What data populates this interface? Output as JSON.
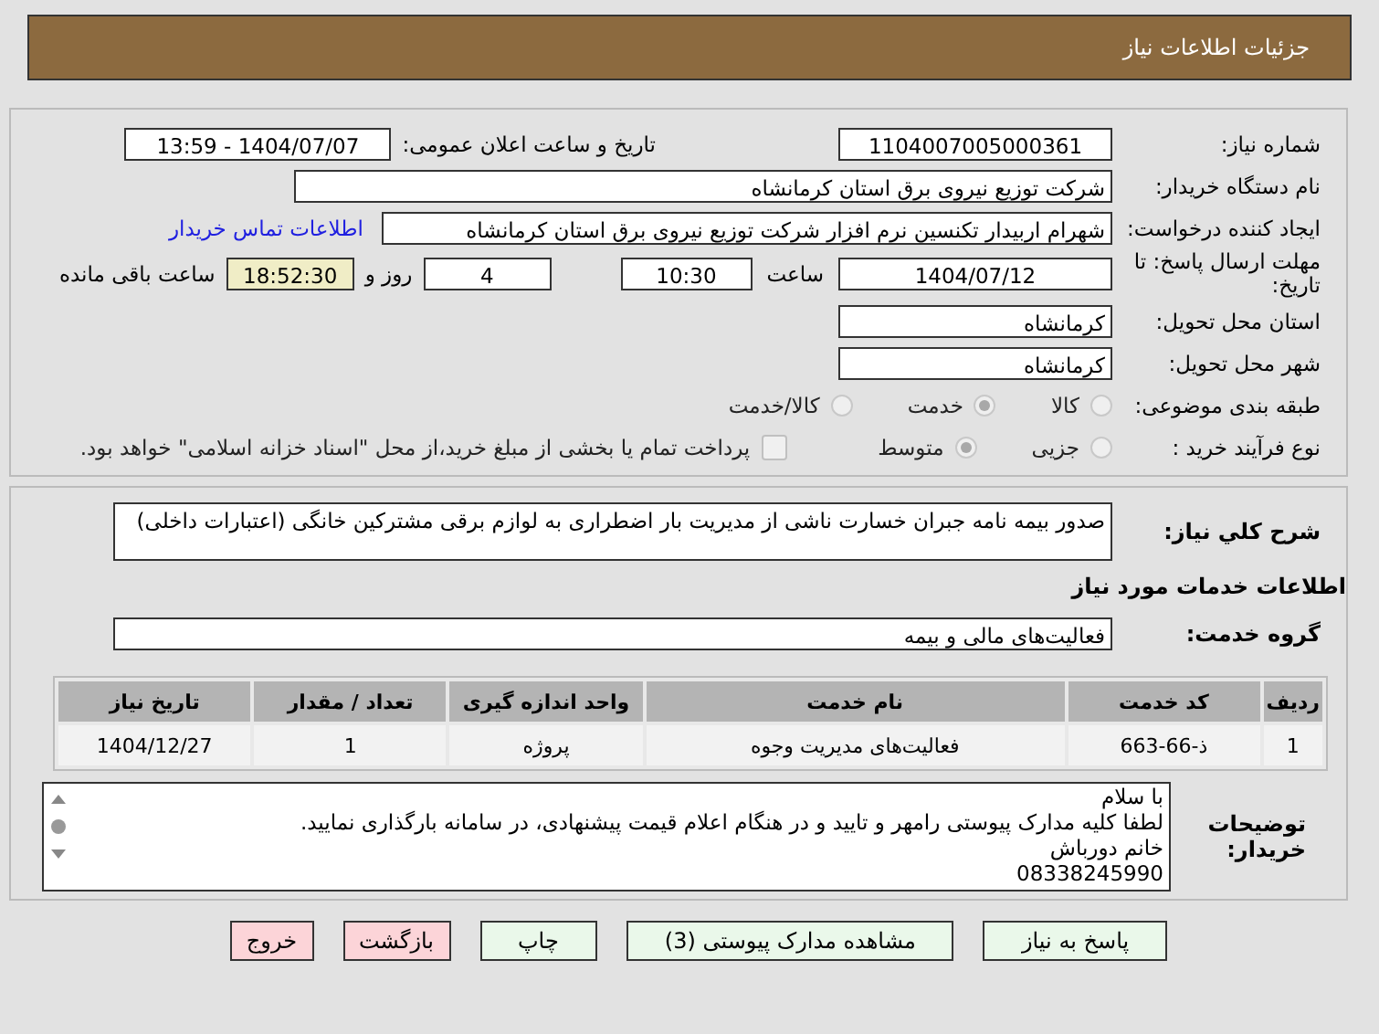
{
  "header": {
    "title": "جزئیات اطلاعات نیاز"
  },
  "details": {
    "need_number": {
      "label": "شماره نیاز:",
      "value": "1104007005000361"
    },
    "announce": {
      "label": "تاریخ و ساعت اعلان عمومی:",
      "value": "1404/07/07 - 13:59"
    },
    "buyer": {
      "label": "نام دستگاه خریدار:",
      "value": "شرکت توزیع نیروی برق استان کرمانشاه"
    },
    "creator": {
      "label": "ایجاد کننده درخواست:",
      "value": "شهرام اربیدار تکنسین نرم افزار شرکت توزیع نیروی برق استان کرمانشاه",
      "link": "اطلاعات تماس خریدار"
    },
    "deadline": {
      "label": "مهلت ارسال پاسخ: تا تاریخ:",
      "date": "1404/07/12",
      "time_label": "ساعت",
      "time": "10:30",
      "days": "4",
      "days_label": "روز و",
      "remaining": "18:52:30",
      "remaining_label": "ساعت باقی مانده"
    },
    "province": {
      "label": "استان محل تحویل:",
      "value": "کرمانشاه"
    },
    "city": {
      "label": "شهر محل تحویل:",
      "value": "کرمانشاه"
    },
    "category": {
      "label": "طبقه بندی موضوعی:",
      "options": [
        {
          "label": "کالا",
          "selected": false
        },
        {
          "label": "خدمت",
          "selected": true
        },
        {
          "label": "کالا/خدمت",
          "selected": false
        }
      ]
    },
    "process": {
      "label": "نوع فرآیند خرید :",
      "options": [
        {
          "label": "جزیی",
          "selected": false
        },
        {
          "label": "متوسط",
          "selected": true
        }
      ],
      "payment": {
        "checked": false,
        "text": "پرداخت تمام یا بخشی از مبلغ خرید،از محل \"اسناد خزانه اسلامی\" خواهد بود."
      }
    }
  },
  "summary": {
    "label": "شرح کلي نیاز:",
    "value": "صدور بیمه نامه جبران خسارت ناشی از مدیریت بار اضطراری به لوازم برقی مشترکین خانگی (اعتبارات داخلی)"
  },
  "services_title": "اطلاعات خدمات مورد نیاز",
  "service_group": {
    "label": "گروه خدمت:",
    "value": "فعالیت‌های مالی و بیمه"
  },
  "table": {
    "columns": [
      "ردیف",
      "کد خدمت",
      "نام خدمت",
      "واحد اندازه گیری",
      "تعداد / مقدار",
      "تاریخ نیاز"
    ],
    "rows": [
      [
        "1",
        "ذ-66-663",
        "فعالیت‌های مدیریت وجوه",
        "پروژه",
        "1",
        "1404/12/27"
      ]
    ]
  },
  "buyer_notes": {
    "label": "توضیحات خریدار:",
    "lines": [
      "با سلام",
      "لطفا کلیه مدارک پیوستی رامهر و تایید و در هنگام اعلام قیمت پیشنهادی، در سامانه بارگذاری نمایید.",
      "خانم دورباش",
      "08338245990"
    ]
  },
  "buttons": [
    {
      "label": "پاسخ به نیاز",
      "kind": "primary"
    },
    {
      "label": "مشاهده مدارک پیوستی (3)",
      "kind": "primary"
    },
    {
      "label": "چاپ",
      "kind": "primary"
    },
    {
      "label": "بازگشت",
      "kind": "danger"
    },
    {
      "label": "خروج",
      "kind": "danger"
    }
  ]
}
